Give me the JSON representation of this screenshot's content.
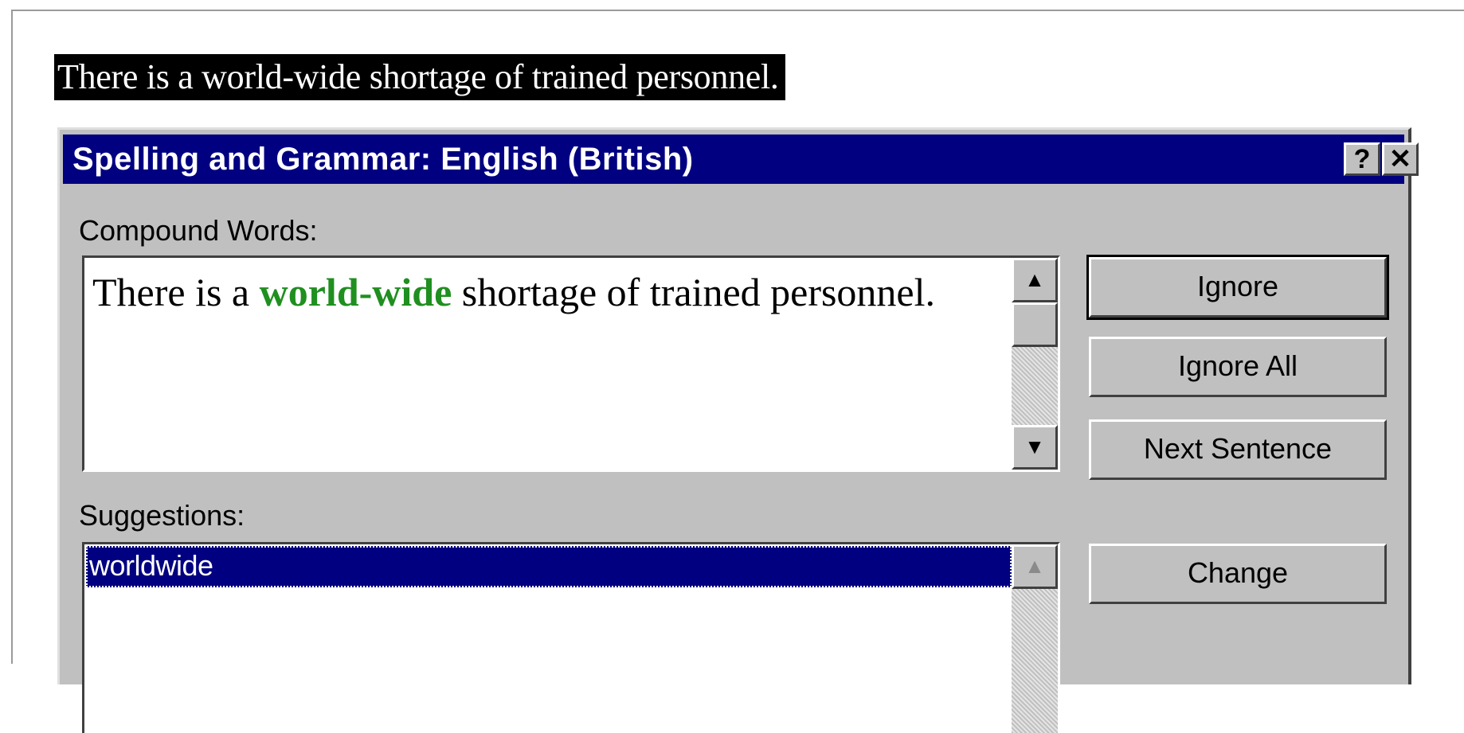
{
  "document": {
    "selected_sentence": "There is a world-wide shortage of trained personnel."
  },
  "dialog": {
    "title": "Spelling and Grammar: English (British)",
    "help_glyph": "?",
    "close_glyph": "✕",
    "problem_label": "Compound Words:",
    "sentence": {
      "before": "There is a ",
      "flagged": "world-wide",
      "after": " shortage of trained personnel."
    },
    "suggestions_label": "Suggestions:",
    "suggestions": [
      "worldwide"
    ],
    "buttons": {
      "ignore": "Ignore",
      "ignore_all": "Ignore All",
      "next_sentence": "Next Sentence",
      "change": "Change"
    },
    "colors": {
      "titlebar": "#000080",
      "flagged_text": "#1f8f1f",
      "face": "#c0c0c0"
    },
    "icons": {
      "scroll_up": "▲",
      "scroll_down": "▼"
    }
  }
}
